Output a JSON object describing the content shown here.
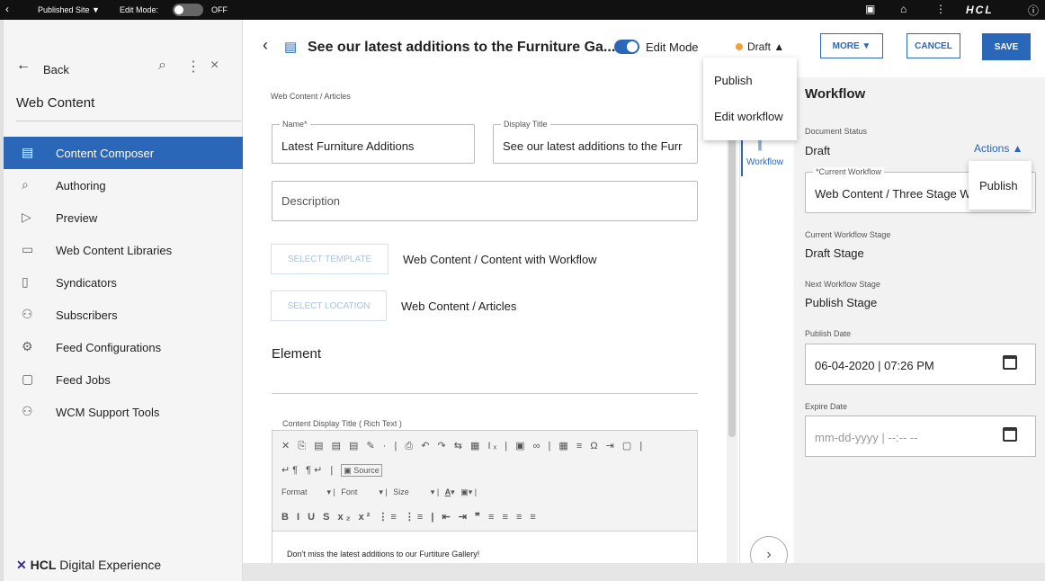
{
  "topbar": {
    "back_icon": "chevron-left-icon",
    "site": "Published Site ▼",
    "edit_mode_label": "Edit Mode:",
    "edit_mode_state": "OFF",
    "brand": "HCL"
  },
  "sidebar": {
    "back": "Back",
    "title": "Web Content",
    "items": [
      {
        "label": "Content Composer",
        "icon": "list-icon"
      },
      {
        "label": "Authoring",
        "icon": "search-icon"
      },
      {
        "label": "Preview",
        "icon": "play-icon"
      },
      {
        "label": "Web Content Libraries",
        "icon": "folder-icon"
      },
      {
        "label": "Syndicators",
        "icon": "document-icon"
      },
      {
        "label": "Subscribers",
        "icon": "users-icon"
      },
      {
        "label": "Feed Configurations",
        "icon": "gear-icon"
      },
      {
        "label": "Feed Jobs",
        "icon": "clipboard-icon"
      },
      {
        "label": "WCM Support Tools",
        "icon": "users-icon"
      }
    ],
    "brand_bold": "HCL",
    "brand_rest": " Digital Experience"
  },
  "header": {
    "title": "See our latest additions to the Furniture Ga...",
    "edit_mode": "Edit Mode",
    "status": "Draft ▲",
    "more": "MORE ▼",
    "cancel": "CANCEL",
    "save": "SAVE"
  },
  "draft_menu": [
    "Publish",
    "Edit workflow"
  ],
  "form": {
    "breadcrumb": "Web Content / Articles",
    "name_label": "Name*",
    "name_value": "Latest Furniture Additions",
    "display_title_label": "Display Title",
    "display_title_value": "See our latest additions to the Furr",
    "description_placeholder": "Description",
    "select_template": "SELECT TEMPLATE",
    "template_value": "Web Content / Content with Workflow",
    "select_location": "SELECT LOCATION",
    "location_value": "Web Content / Articles",
    "element_heading": "Element",
    "rich_text_label": "Content Display Title ( Rich Text )",
    "toolbar_row1": "✕ ⎘ ▤ ▤ ▤ ✎ · | ⎙ ↶ ↷ ⇆ ▦ Iₓ | ▣ ∞ | ▦ ≡ Ω ⇥ ▢ |",
    "toolbar_row2": "↵¶ ¶↵ | ",
    "toolbar_source": "Source",
    "toolbar_format": "Format",
    "toolbar_font": "Font",
    "toolbar_size": "Size",
    "toolbar_row4": "B I U S x₂ x² ⋮≡ ⋮≡ | ⇤ ⇥ ❞ ≡ ≡ ≡ ≡",
    "editor_text": "Don't miss the latest additions to our Furtiture Gallery!"
  },
  "side_tab": {
    "label": "Workflow"
  },
  "workflow": {
    "title": "Workflow",
    "doc_status_label": "Document Status",
    "doc_status_value": "Draft",
    "actions": "Actions ▲",
    "current_workflow_label": "*Current Workflow",
    "current_workflow_value": "Web Content / Three Stage W",
    "current_stage_label": "Current Workflow Stage",
    "current_stage_value": "Draft Stage",
    "next_stage_label": "Next Workflow Stage",
    "next_stage_value": "Publish Stage",
    "publish_date_label": "Publish Date",
    "publish_date_value": "06-04-2020 | 07:26 PM",
    "expire_date_label": "Expire Date",
    "expire_date_placeholder": "mm-dd-yyyy | --:-- --",
    "actions_menu": [
      "Publish"
    ]
  }
}
